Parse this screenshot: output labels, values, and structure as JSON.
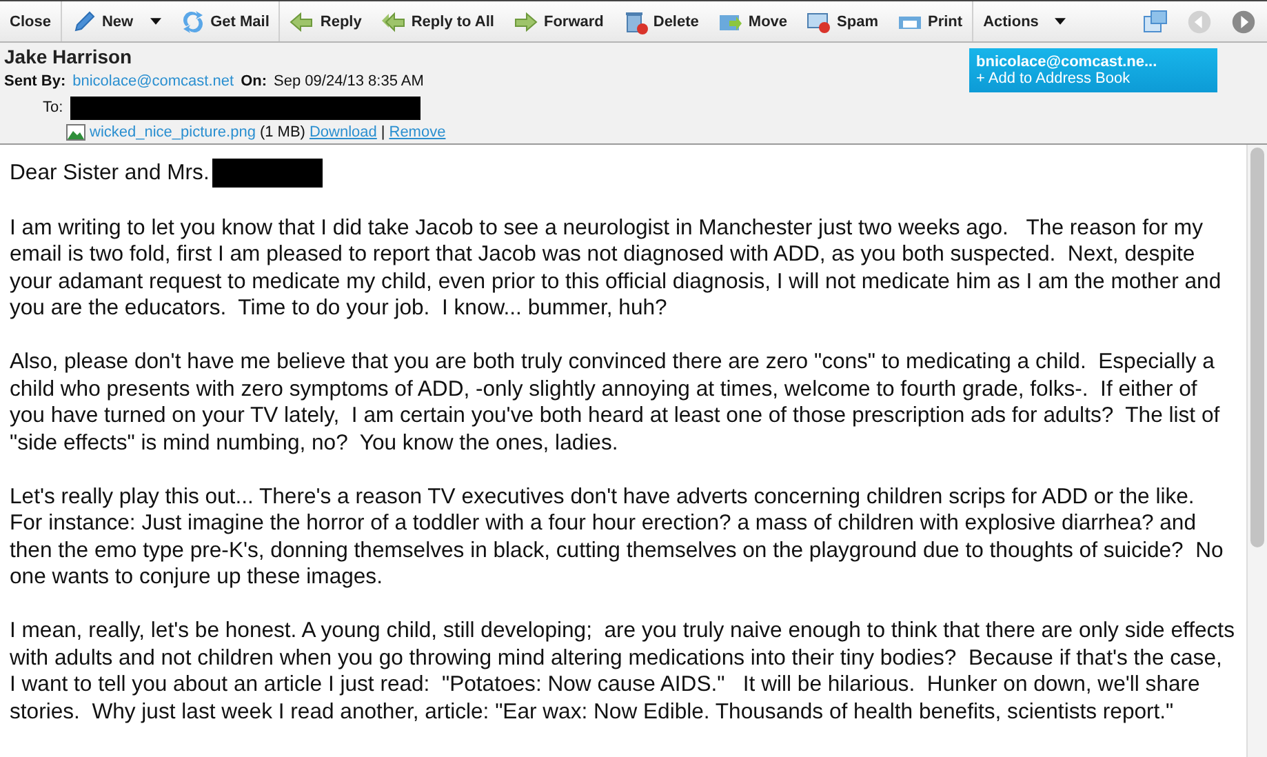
{
  "toolbar": [
    {
      "label": "Close",
      "kind": "plain",
      "dropdown": false
    },
    {
      "label": "New",
      "kind": "pencil",
      "dropdown": true
    },
    {
      "label": "Get Mail",
      "kind": "sync",
      "dropdown": false
    },
    {
      "label": "Reply",
      "kind": "reply",
      "dropdown": false
    },
    {
      "label": "Reply to All",
      "kind": "replyall",
      "dropdown": false
    },
    {
      "label": "Forward",
      "kind": "forward",
      "dropdown": false
    },
    {
      "label": "Delete",
      "kind": "trash",
      "dropdown": false
    },
    {
      "label": "Move",
      "kind": "folder",
      "dropdown": false
    },
    {
      "label": "Spam",
      "kind": "spam",
      "dropdown": false
    },
    {
      "label": "Print",
      "kind": "print",
      "dropdown": false
    },
    {
      "label": "Actions",
      "kind": "plain",
      "dropdown": true
    }
  ],
  "header": {
    "sender_name": "Jake Harrison",
    "sent_by_label": "Sent By:",
    "sent_by": "bnicolace@comcast.net",
    "on_label": "On:",
    "date": "Sep 09/24/13 8:35 AM",
    "to_label": "To:",
    "to_redacted": true,
    "attachment": {
      "name": "wicked_nice_picture.png",
      "size": "(1 MB)",
      "download": "Download",
      "separator": "|",
      "remove": "Remove"
    },
    "contact_card": {
      "email": "bnicolace@comcast.ne...",
      "add": "+ Add to Address Book"
    }
  },
  "body": {
    "greeting": "Dear Sister and Mrs.",
    "greeting_redacted": true,
    "paragraphs": [
      "I am writing to let you know that I did take Jacob to see a neurologist in Manchester just two weeks ago.   The reason for my email is two fold, first I am pleased to report that Jacob was not diagnosed with ADD, as you both suspected.  Next, despite your adamant request to medicate my child, even prior to this official diagnosis, I will not medicate him as I am the mother and you are the educators.  Time to do your job.  I know... bummer, huh?",
      "Also, please don't have me believe that you are both truly convinced there are zero \"cons\" to medicating a child.  Especially a child who presents with zero symptoms of ADD, -only slightly annoying at times, welcome to fourth grade, folks-.  If either of you have turned on your TV lately,  I am certain you've both heard at least one of those prescription ads for adults?  The list of \"side effects\" is mind numbing, no?  You know the ones, ladies.",
      "Let's really play this out... There's a reason TV executives don't have adverts concerning children scrips for ADD or the like.  For instance: Just imagine the horror of a toddler with a four hour erection? a mass of children with explosive diarrhea? and then the emo type pre-K's, donning themselves in black, cutting themselves on the playground due to thoughts of suicide?  No one wants to conjure up these images.",
      "I mean, really, let's be honest. A young child, still developing;  are you truly naive enough to think that there are only side effects with adults and not children when you go throwing mind altering medications into their tiny bodies?  Because if that's the case,  I want to tell you about an article I just read:  \"Potatoes: Now cause AIDS.\"   It will be hilarious.  Hunker on down, we'll share stories.  Why just last week I read another, article: \"Ear wax: Now Edible. Thousands of health benefits, scientists report.\""
    ]
  }
}
